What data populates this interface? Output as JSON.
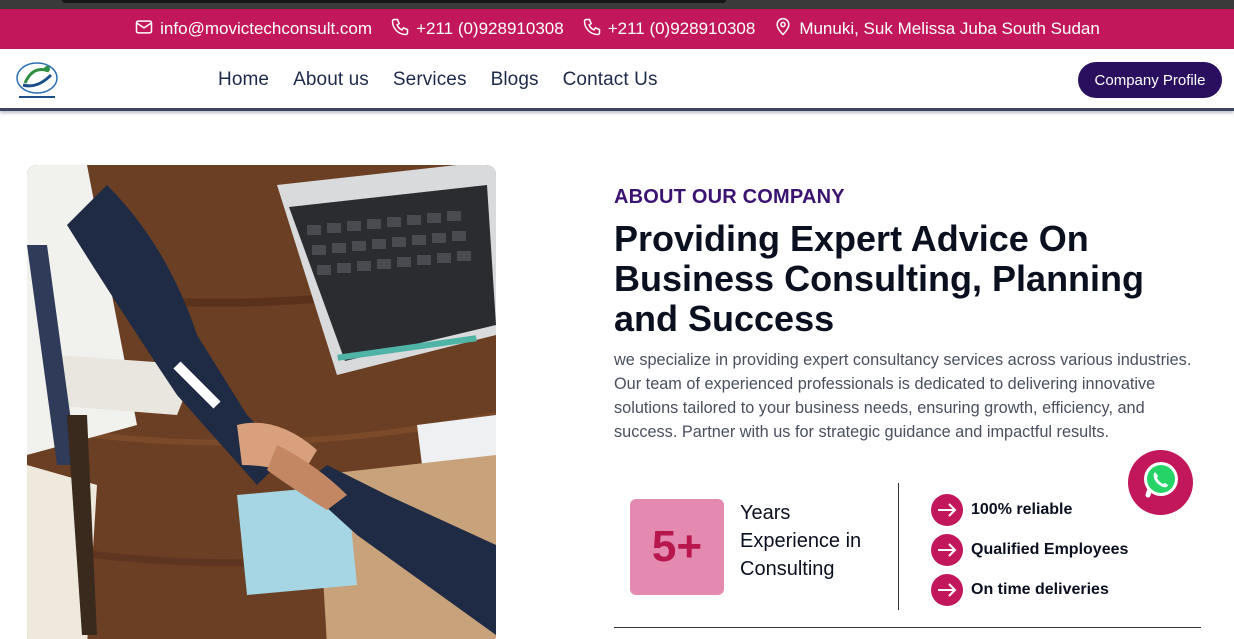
{
  "topbar": {
    "email": "info@movictechconsult.com",
    "phone1": "+211 (0)928910308",
    "phone2": "+211 (0)928910308",
    "address": "Munuki, Suk Melissa Juba South Sudan"
  },
  "nav": {
    "items": [
      "Home",
      "About us",
      "Services",
      "Blogs",
      "Contact Us"
    ],
    "profile_button": "Company Profile"
  },
  "about": {
    "eyebrow": "ABOUT OUR COMPANY",
    "heading": "Providing Expert Advice On Business Consulting, Planning and Success",
    "paragraph": "we specialize in providing expert consultancy services across various industries. Our team of experienced professionals is dedicated to delivering innovative solutions tailored to your business needs, ensuring growth, efficiency, and success. Partner with us for strategic guidance and impactful results.",
    "experience_value": "5+",
    "experience_label": "Years Experience in Consulting",
    "features": [
      "100% reliable",
      "Qualified Employees",
      "On time deliveries"
    ]
  },
  "colors": {
    "brand_pink": "#c2185b",
    "brand_purple": "#2a0f5e",
    "experience_box": "#e48ab1"
  },
  "icons": {
    "email": "mail-icon",
    "phone": "phone-icon",
    "address": "location-pin-icon",
    "feature": "arrow-right-icon",
    "float": "whatsapp-icon"
  }
}
